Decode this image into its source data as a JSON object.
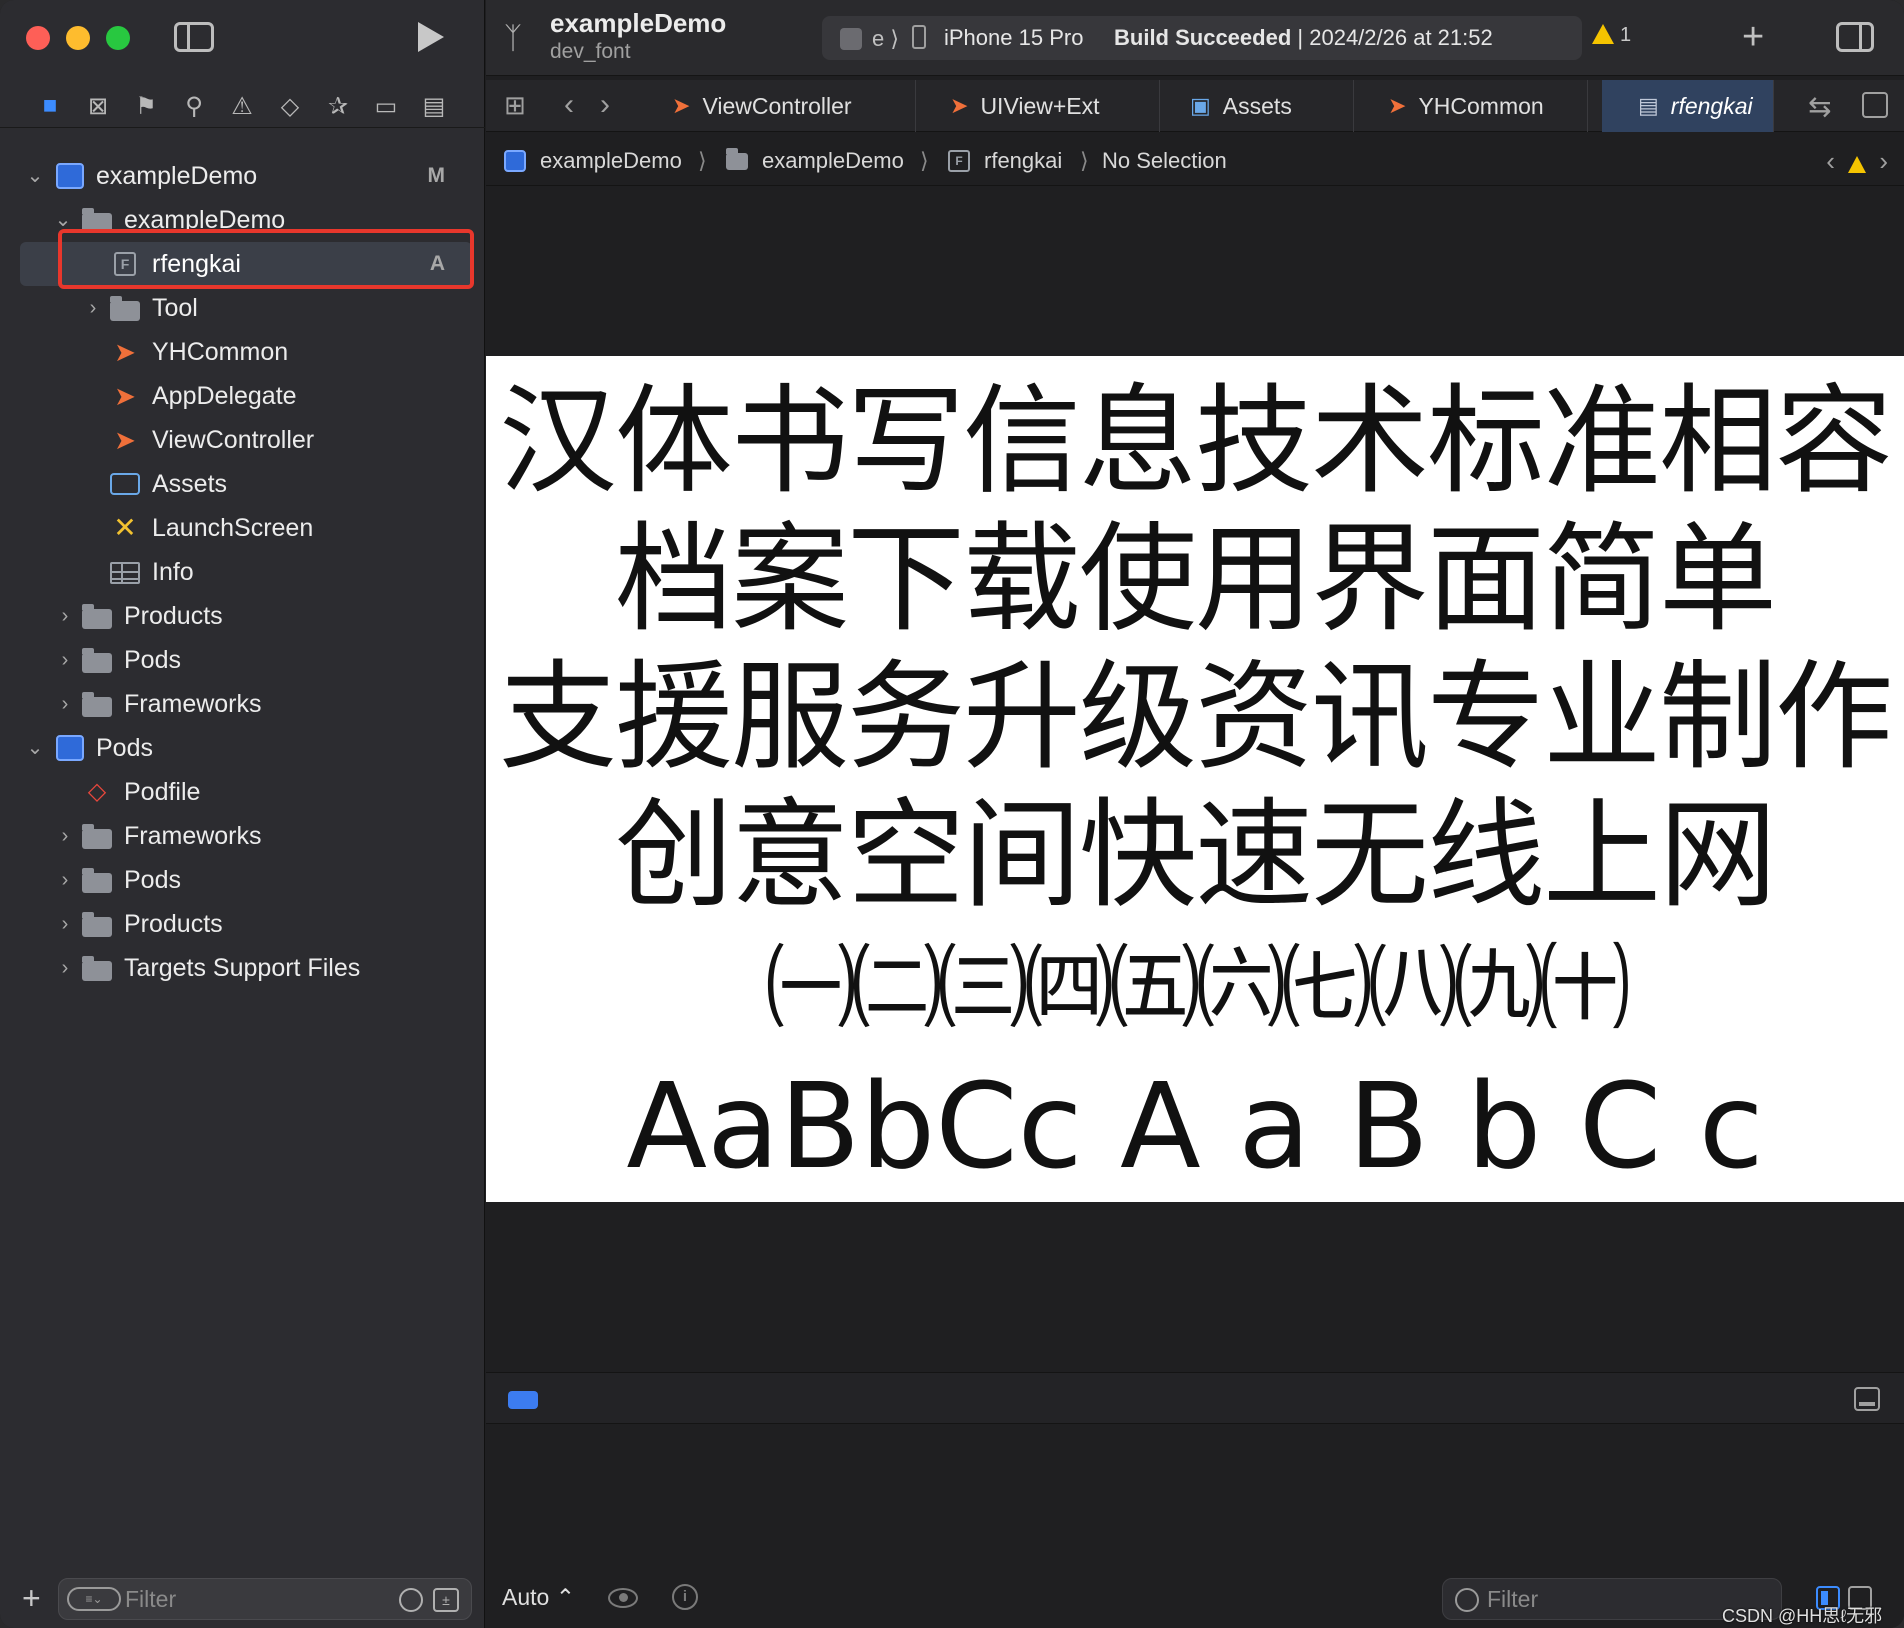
{
  "window": {
    "project_title": "exampleDemo",
    "branch": "dev_font"
  },
  "toolbar": {
    "scheme_short": "e",
    "device": "iPhone 15 Pro",
    "build_status": "Build Succeeded",
    "build_time": "| 2024/2/26 at 21:52",
    "warning_count": "1",
    "add_label": "+"
  },
  "tabs": [
    {
      "label": "ViewController",
      "icon": "swift-icon"
    },
    {
      "label": "UIView+Ext",
      "icon": "swift-icon"
    },
    {
      "label": "Assets",
      "icon": "assets-icon"
    },
    {
      "label": "YHCommon",
      "icon": "swift-icon"
    },
    {
      "label": "rfengkai",
      "icon": "font-file-icon",
      "active": true
    }
  ],
  "breadcrumb": {
    "items": [
      "exampleDemo",
      "exampleDemo",
      "rfengkai",
      "No Selection"
    ]
  },
  "navigator": {
    "items": [
      {
        "label": "exampleDemo",
        "type": "project",
        "badge": "M",
        "expanded": true
      },
      {
        "label": "exampleDemo",
        "type": "folder",
        "expanded": true
      },
      {
        "label": "rfengkai",
        "type": "font-file",
        "badge": "A",
        "selected": true
      },
      {
        "label": "Tool",
        "type": "folder",
        "expanded": false
      },
      {
        "label": "YHCommon",
        "type": "swift"
      },
      {
        "label": "AppDelegate",
        "type": "swift"
      },
      {
        "label": "ViewController",
        "type": "swift"
      },
      {
        "label": "Assets",
        "type": "assets"
      },
      {
        "label": "LaunchScreen",
        "type": "storyboard"
      },
      {
        "label": "Info",
        "type": "plist"
      },
      {
        "label": "Products",
        "type": "folder",
        "expanded": false
      },
      {
        "label": "Pods",
        "type": "folder",
        "expanded": false
      },
      {
        "label": "Frameworks",
        "type": "folder",
        "expanded": false
      },
      {
        "label": "Pods",
        "type": "project",
        "expanded": true
      },
      {
        "label": "Podfile",
        "type": "ruby"
      },
      {
        "label": "Frameworks",
        "type": "folder",
        "expanded": false
      },
      {
        "label": "Pods",
        "type": "folder",
        "expanded": false
      },
      {
        "label": "Products",
        "type": "folder",
        "expanded": false
      },
      {
        "label": "Targets Support Files",
        "type": "folder",
        "expanded": false
      }
    ],
    "filter_placeholder": "Filter"
  },
  "font_preview": {
    "lines": [
      "汉体书写信息技术标准相容",
      "档案下载使用界面简单",
      "支援服务升级资讯专业制作",
      "创意空间快速无线上网",
      "㈠㈡㈢㈣㈤㈥㈦㈧㈨㈩",
      "AaBbCc  A a B b C c"
    ]
  },
  "debug": {
    "auto_label": "Auto ⌃",
    "filter_placeholder": "Filter"
  },
  "watermark": "CSDN @HH思ℓ无邪",
  "colors": {
    "accent": "#3c8cff",
    "highlight_border": "#e8372c",
    "warning": "#f5c400",
    "swift": "#f0703a"
  }
}
